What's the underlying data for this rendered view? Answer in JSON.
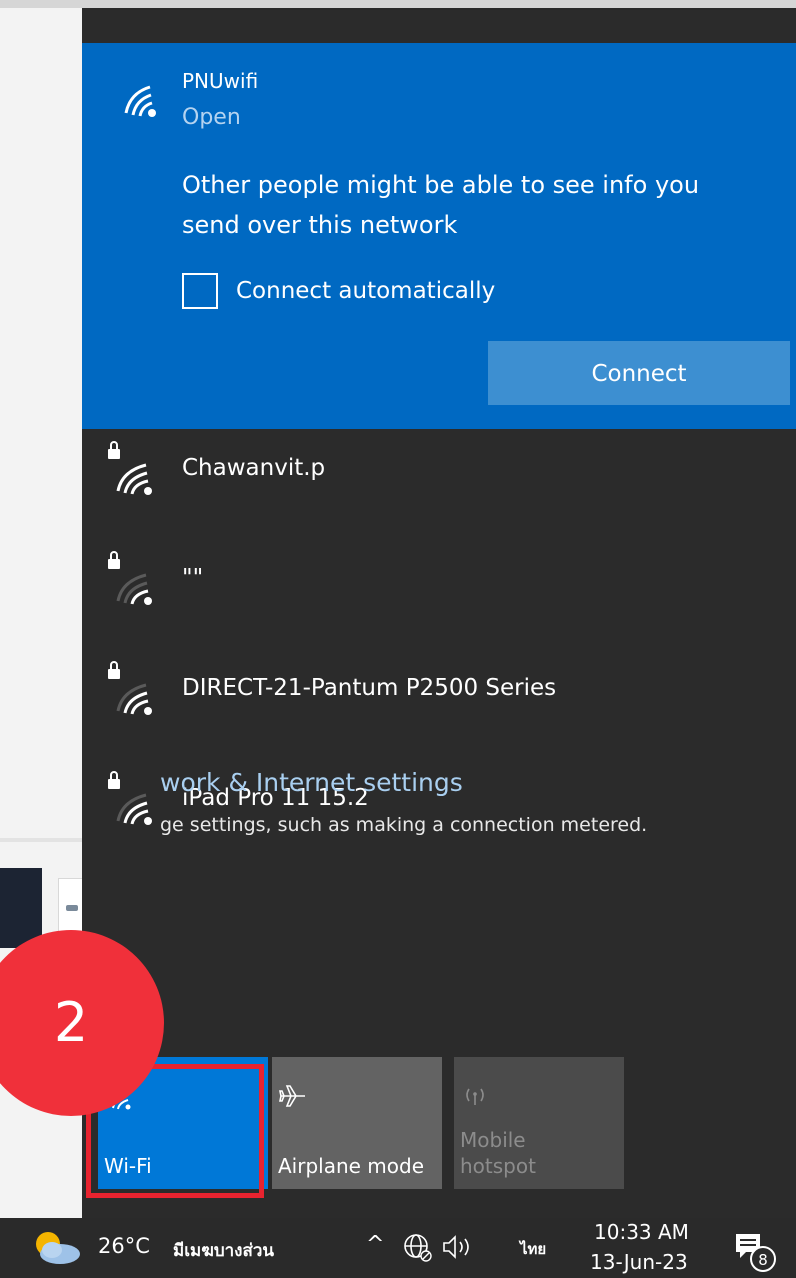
{
  "selected_network": {
    "ssid": "PNUwifi",
    "status": "Open",
    "warning": "Other people might be able to see info you send over this network",
    "connect_auto_label": "Connect automatically",
    "connect_auto_checked": false,
    "connect_button": "Connect"
  },
  "networks": [
    {
      "name": "Chawanvit.p",
      "secured": true,
      "signal": "full"
    },
    {
      "name": "\"\"",
      "secured": true,
      "signal": "low"
    },
    {
      "name": "DIRECT-21-Pantum P2500 Series",
      "secured": true,
      "signal": "low"
    },
    {
      "name": "iPad Pro 11 15.2",
      "secured": true,
      "signal": "low"
    }
  ],
  "settings": {
    "title": "work & Internet settings",
    "subtitle": "ge settings, such as making a connection metered."
  },
  "quick_actions": {
    "wifi": "Wi-Fi",
    "airplane": "Airplane mode",
    "hotspot_line1": "Mobile",
    "hotspot_line2": "hotspot"
  },
  "annotation": {
    "step": "2",
    "color": "#f0303a"
  },
  "taskbar": {
    "temperature": "26°C",
    "condition": "มีเมฆบางส่วน",
    "language": "ไทย",
    "time": "10:33 AM",
    "date": "13-Jun-23",
    "notification_count": "8"
  },
  "colors": {
    "accent": "#0069c2",
    "flyout_bg": "#2b2b2b",
    "tile_active": "#0078d7",
    "highlight": "#e8232f"
  }
}
